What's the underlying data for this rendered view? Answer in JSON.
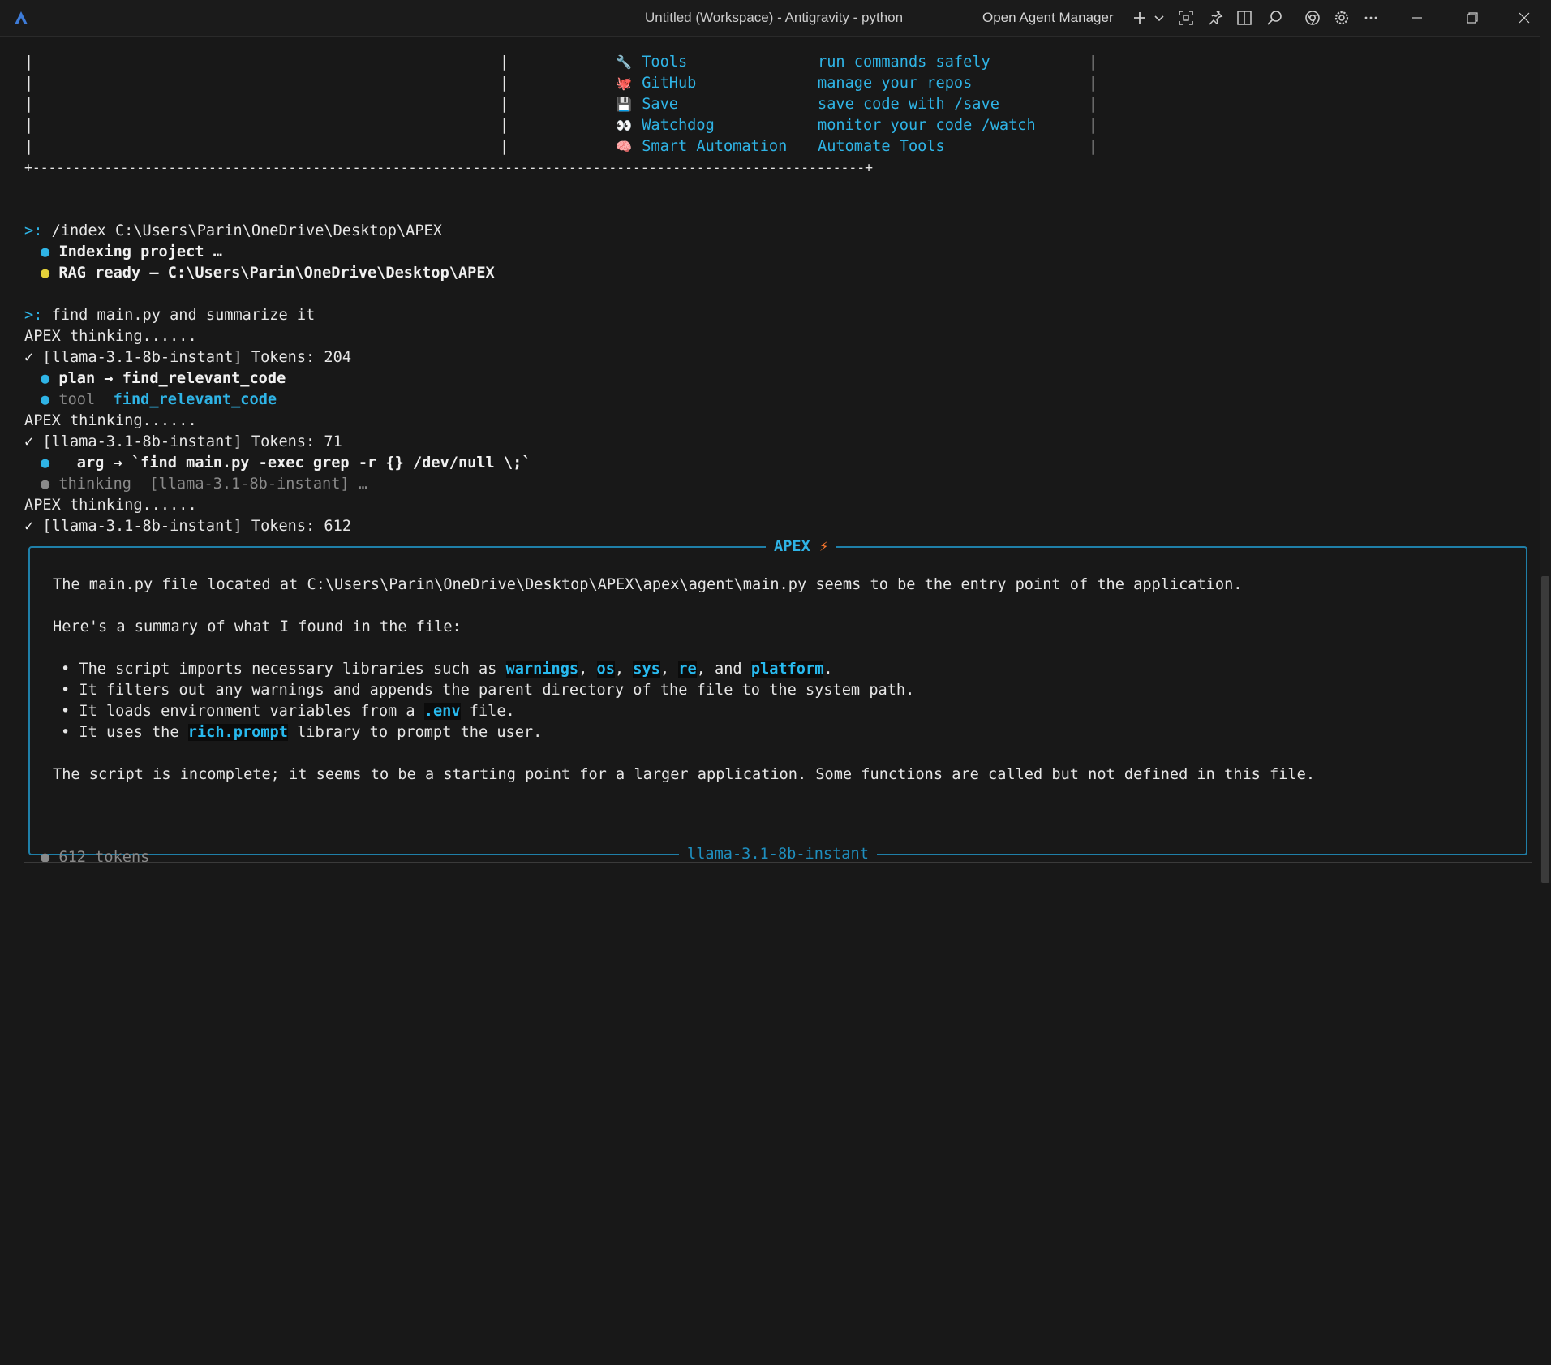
{
  "window": {
    "title": "Untitled (Workspace) - Antigravity - python",
    "agent_manager_label": "Open Agent Manager"
  },
  "icons": {
    "logo": "antigravity-logo-icon",
    "add": "plus-icon",
    "chevron": "chevron-down-icon",
    "focus": "focus-frame-icon",
    "pin": "pin-icon",
    "layout": "split-layout-icon",
    "search": "search-icon",
    "browser": "chrome-icon",
    "settings": "gear-icon",
    "more": "ellipsis-icon"
  },
  "colors": {
    "accent": "#2fb4e6",
    "panel_border": "#1f7fa8",
    "bolt": "#ff7a2e",
    "ready_dot": "#e5d23a"
  },
  "tools_table": {
    "border_left": "|",
    "border_mid": "|",
    "border_right": "|",
    "bottom_border": "+--------------------------------------------------------------------------------------------------------+",
    "rows": [
      {
        "emoji": "🔧",
        "name": "Tools",
        "desc": "run commands safely"
      },
      {
        "emoji": "🐙",
        "name": "GitHub",
        "desc": "manage your repos"
      },
      {
        "emoji": "💾",
        "name": "Save",
        "desc": "save code with /save"
      },
      {
        "emoji": "👀",
        "name": "Watchdog",
        "desc": "monitor your code /watch"
      },
      {
        "emoji": "🧠",
        "name": "Smart Automation",
        "desc": "Automate Tools"
      }
    ]
  },
  "log": {
    "prompt": ">:",
    "cmd1": " /index C:\\Users\\Parin\\OneDrive\\Desktop\\APEX",
    "indexing": "Indexing project …",
    "rag_ready": "RAG ready — C:\\Users\\Parin\\OneDrive\\Desktop\\APEX",
    "cmd2": " find main.py and summarize it",
    "thinking": "APEX thinking......",
    "tick": "✓",
    "tokens1": "[llama-3.1-8b-instant] Tokens: 204",
    "plan": "plan → find_relevant_code",
    "tool_label": "tool",
    "tool_name": "find_relevant_code",
    "tokens2": "[llama-3.1-8b-instant] Tokens: 71",
    "arg": "arg → `find main.py -exec grep -r {} /dev/null \\;`",
    "thinking_dim": "thinking  [llama-3.1-8b-instant] …",
    "tokens3": "[llama-3.1-8b-instant] Tokens: 612"
  },
  "panel": {
    "title": "APEX",
    "bolt": "⚡",
    "intro": "The main.py file located at C:\\Users\\Parin\\OneDrive\\Desktop\\APEX\\apex\\agent\\main.py seems to be the entry point of the application.",
    "summary_heading": "Here's a summary of what I found in the file:",
    "b1_pre": "The script imports necessary libraries such as ",
    "b1_warnings": "warnings",
    "b1_os": "os",
    "b1_sys": "sys",
    "b1_re": "re",
    "b1_and": ", and ",
    "b1_platform": "platform",
    "b2": "It filters out any warnings and appends the parent directory of the file to the system path.",
    "b3_pre": "It loads environment variables from a ",
    "b3_env": ".env",
    "b3_post": " file.",
    "b4_pre": "It uses the ",
    "b4_rich": "rich.prompt",
    "b4_post": " library to prompt the user.",
    "conclusion": "The script is incomplete; it seems to be a starting point for a larger application. Some functions are called but not defined in this file.",
    "footer": "llama-3.1-8b-instant"
  },
  "status": {
    "tokens": "612 tokens"
  }
}
